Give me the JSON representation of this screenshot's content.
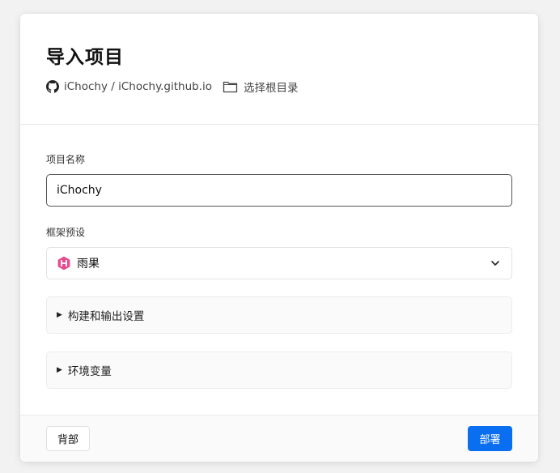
{
  "dialog": {
    "title": "导入项目",
    "repo": {
      "icon": "github-icon",
      "text": "iChochy / iChochy.github.io"
    },
    "root_dir": {
      "icon": "folder-icon",
      "label": "选择根目录"
    }
  },
  "form": {
    "project_name_label": "项目名称",
    "project_name_value": "iChochy",
    "framework_label": "框架预设",
    "framework": {
      "icon": "hexo-icon",
      "value": "雨果",
      "icon_color": "#e64c8c"
    },
    "sections": [
      {
        "label": "构建和输出设置",
        "icon": "triangle-right-icon"
      },
      {
        "label": "环境变量",
        "icon": "triangle-right-icon"
      }
    ]
  },
  "footer": {
    "back_label": "背部",
    "deploy_label": "部署",
    "accent_color": "#0a6ef0"
  }
}
